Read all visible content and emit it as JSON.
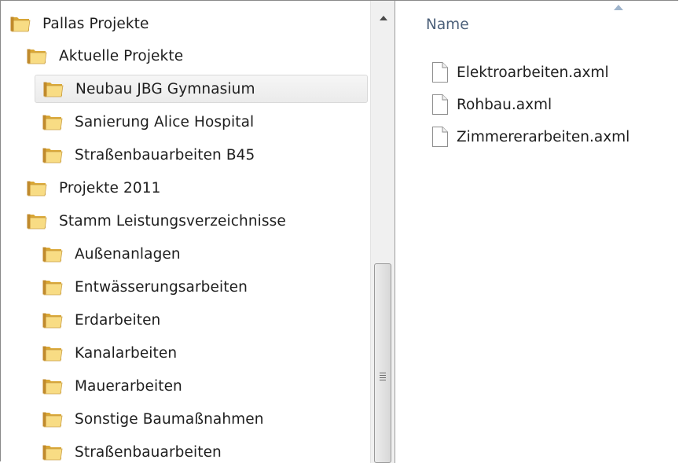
{
  "tree": {
    "items": [
      {
        "label": "Pallas Projekte",
        "level": 0,
        "selected": false
      },
      {
        "label": "Aktuelle Projekte",
        "level": 1,
        "selected": false
      },
      {
        "label": "Neubau JBG Gymnasium",
        "level": 2,
        "selected": true
      },
      {
        "label": "Sanierung Alice Hospital",
        "level": 2,
        "selected": false
      },
      {
        "label": "Straßenbauarbeiten B45",
        "level": 2,
        "selected": false
      },
      {
        "label": "Projekte 2011",
        "level": 1,
        "selected": false
      },
      {
        "label": "Stamm Leistungsverzeichnisse",
        "level": 1,
        "selected": false
      },
      {
        "label": "Außenanlagen",
        "level": 2,
        "selected": false
      },
      {
        "label": "Entwässerungsarbeiten",
        "level": 2,
        "selected": false
      },
      {
        "label": "Erdarbeiten",
        "level": 2,
        "selected": false
      },
      {
        "label": "Kanalarbeiten",
        "level": 2,
        "selected": false
      },
      {
        "label": "Mauerarbeiten",
        "level": 2,
        "selected": false
      },
      {
        "label": "Sonstige Baumaßnahmen",
        "level": 2,
        "selected": false
      },
      {
        "label": "Straßenbauarbeiten",
        "level": 2,
        "selected": false
      }
    ]
  },
  "filelist": {
    "column_header": "Name",
    "files": [
      {
        "name": "Elektroarbeiten.axml"
      },
      {
        "name": "Rohbau.axml"
      },
      {
        "name": "Zimmererarbeiten.axml"
      }
    ]
  },
  "icons": {
    "folder": "folder-icon",
    "file": "file-icon",
    "scroll_up": "scroll-up-arrow-icon",
    "sort": "sort-ascending-icon",
    "grip": "scroll-grip-icon"
  },
  "colors": {
    "folder_light": "#f8dc84",
    "folder_dark": "#d9a634",
    "header_text": "#4c607a",
    "selection": "#ebebeb",
    "scrollbar_track": "#f0f0f0"
  }
}
